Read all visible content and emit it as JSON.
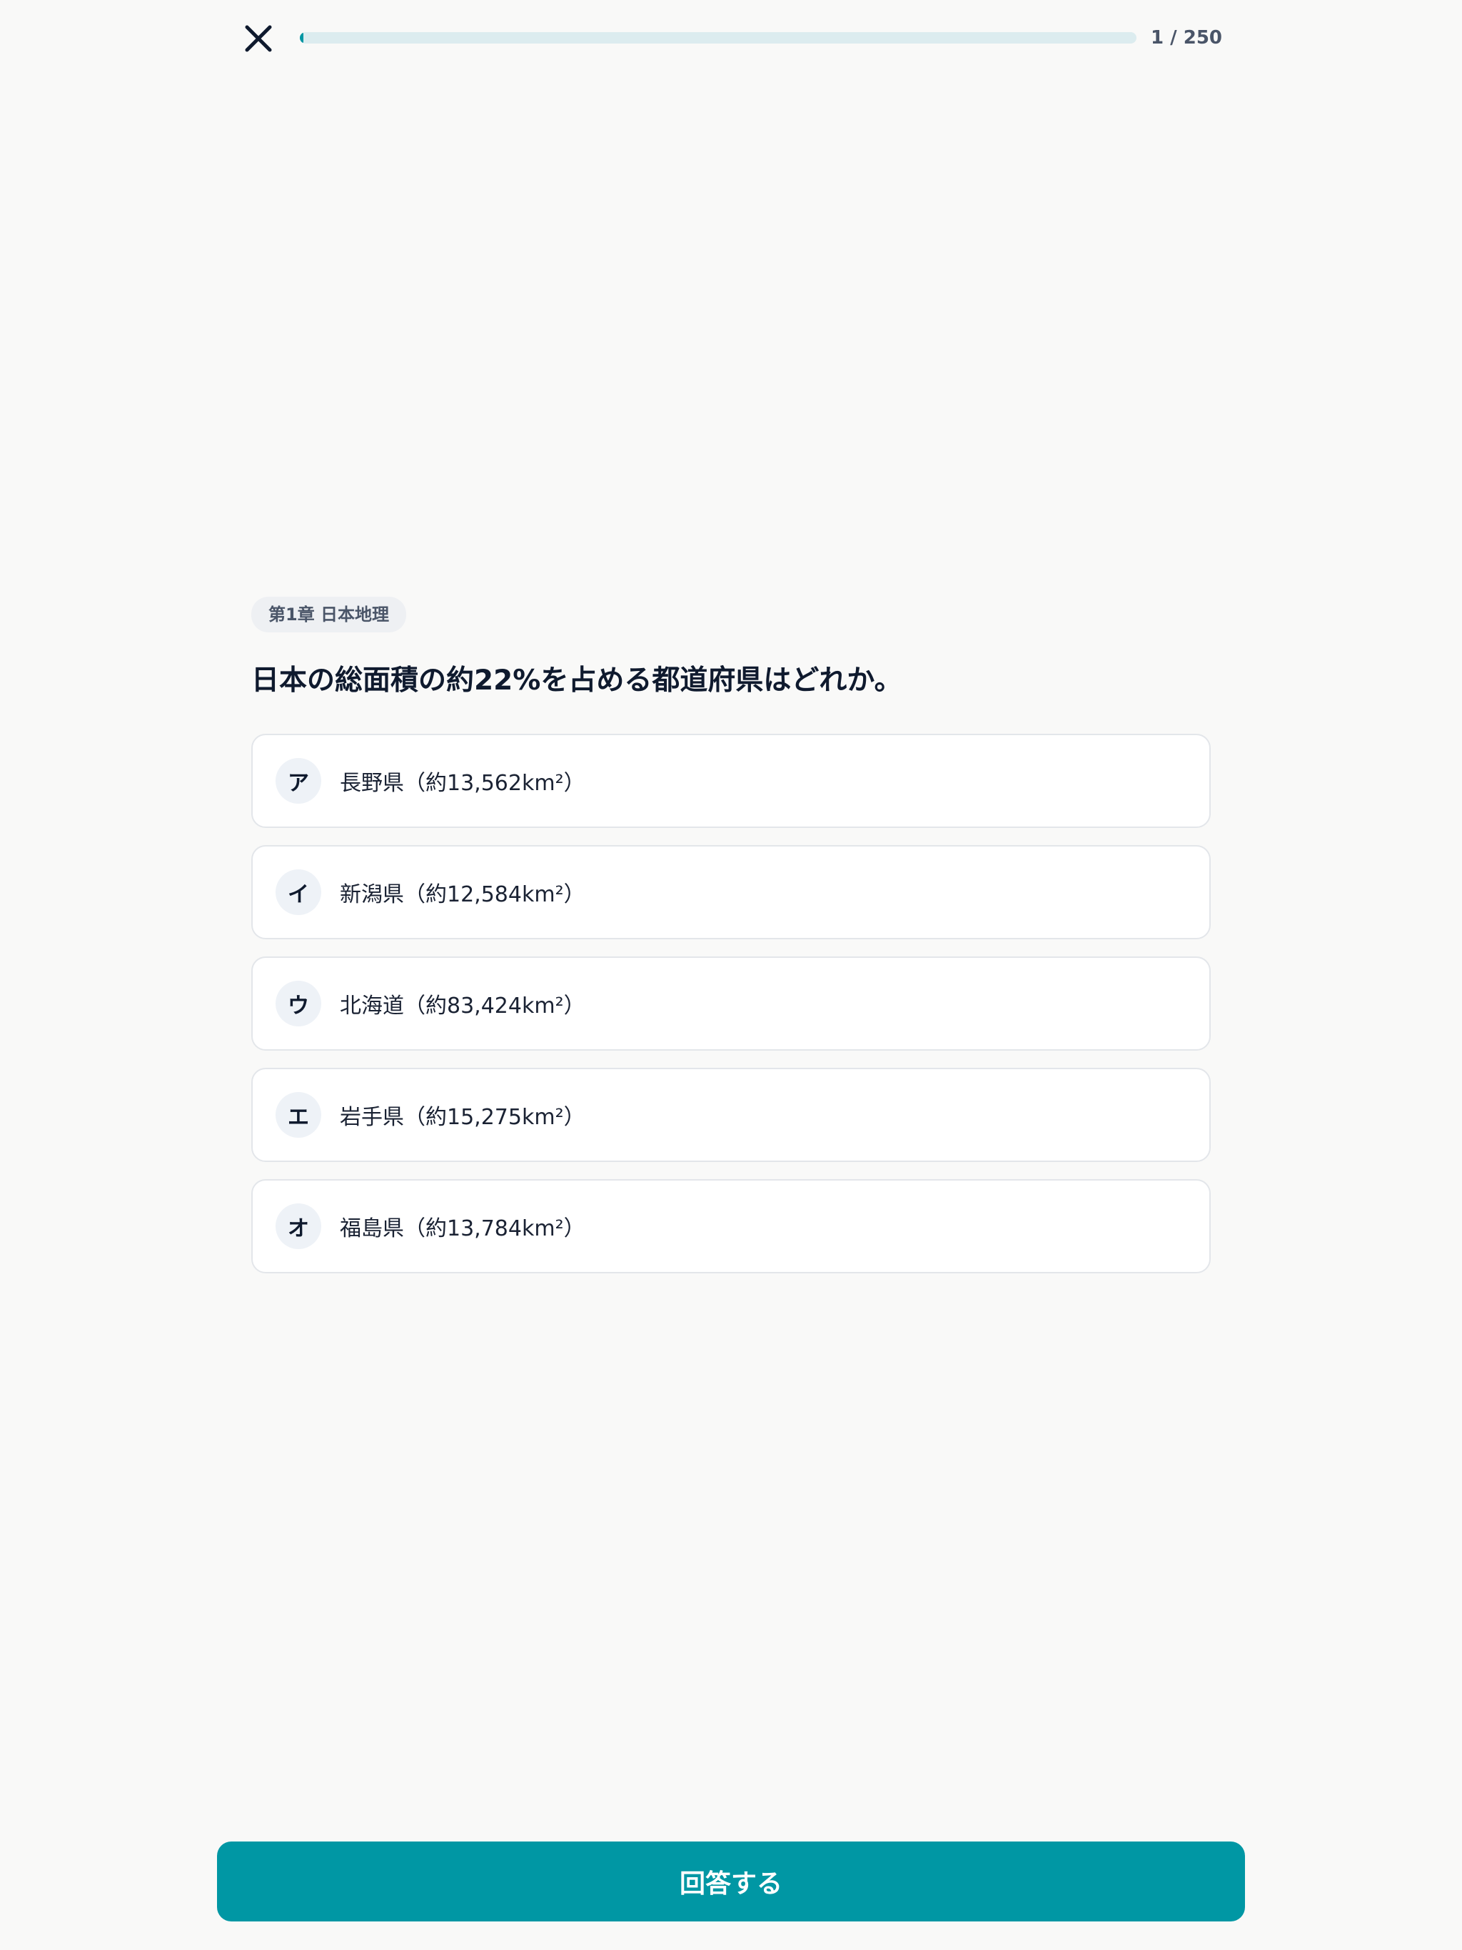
{
  "header": {
    "close_icon": "close-icon",
    "progress": {
      "current": 1,
      "total": 250,
      "label": "1 / 250",
      "fraction": 0.004
    }
  },
  "question": {
    "chapter": "第1章 日本地理",
    "text": "日本の総面積の約22%を占める都道府県はどれか。",
    "options": [
      {
        "letter": "ア",
        "label": "長野県（約13,562km²）"
      },
      {
        "letter": "イ",
        "label": "新潟県（約12,584km²）"
      },
      {
        "letter": "ウ",
        "label": "北海道（約83,424km²）"
      },
      {
        "letter": "エ",
        "label": "岩手県（約15,275km²）"
      },
      {
        "letter": "オ",
        "label": "福島県（約13,784km²）"
      }
    ]
  },
  "footer": {
    "submit_label": "回答する"
  },
  "colors": {
    "accent": "#0097a4",
    "progress_track": "#dcecef",
    "background": "#f9f9f8"
  }
}
